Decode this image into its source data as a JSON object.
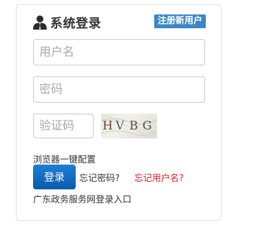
{
  "header": {
    "title": "系统登录",
    "register_label": "注册新用户"
  },
  "form": {
    "username_placeholder": "用户名",
    "password_placeholder": "密码",
    "captcha_placeholder": "验证码",
    "captcha_text": "HVBG"
  },
  "links": {
    "browser_config": "浏览器一键配置",
    "login_label": "登录",
    "forgot_password": "忘记密码?",
    "forgot_username": "忘记用户名?",
    "gd_login": "广东政务服务网登录入口"
  },
  "colors": {
    "register_bg": "#3b86c5",
    "login_bg": "#0b5bab",
    "forgot_username": "#e31a1a"
  },
  "icons": {
    "header_icon": "user-icon"
  }
}
